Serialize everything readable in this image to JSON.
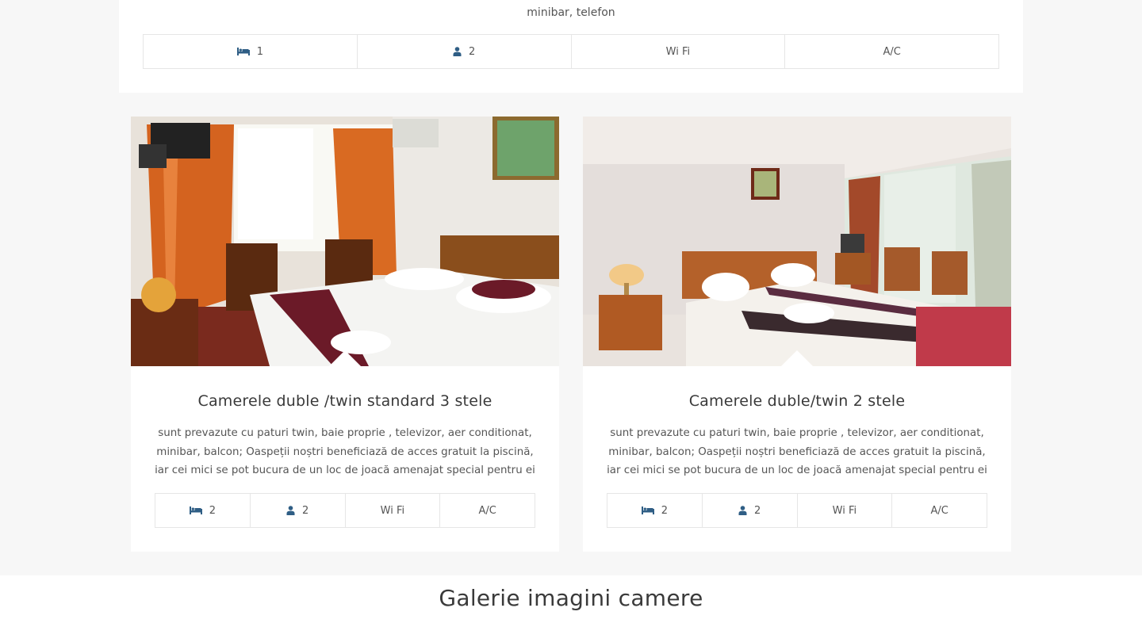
{
  "top_card": {
    "description_tail": "minibar, telefon",
    "features": {
      "beds": "1",
      "persons": "2",
      "wifi": "Wi Fi",
      "ac": "A/C"
    }
  },
  "rooms": [
    {
      "title": "Camerele duble /twin standard 3 stele",
      "description": "sunt prevazute cu paturi twin, baie proprie , televizor, aer conditionat, minibar, balcon; Oaspeții noștri beneficiază de acces gratuit la piscină, iar cei mici se pot bucura de un loc de joacă amenajat special pentru ei",
      "features": {
        "beds": "2",
        "persons": "2",
        "wifi": "Wi Fi",
        "ac": "A/C"
      }
    },
    {
      "title": "Camerele duble/twin 2 stele",
      "description": "sunt prevazute cu paturi twin, baie proprie , televizor, aer conditionat, minibar, balcon; Oaspeții noștri beneficiază de acces gratuit la piscină, iar cei mici se pot bucura de un loc de joacă amenajat special pentru ei",
      "features": {
        "beds": "2",
        "persons": "2",
        "wifi": "Wi Fi",
        "ac": "A/C"
      }
    }
  ],
  "gallery": {
    "title": "Galerie imagini camere"
  },
  "icons": {
    "beds": "bed-icon",
    "persons": "user-icon"
  },
  "colors": {
    "icon_accent": "#2f5e85",
    "page_background": "#f7f7f7",
    "card_background": "#ffffff",
    "border": "#e6e6e6"
  }
}
